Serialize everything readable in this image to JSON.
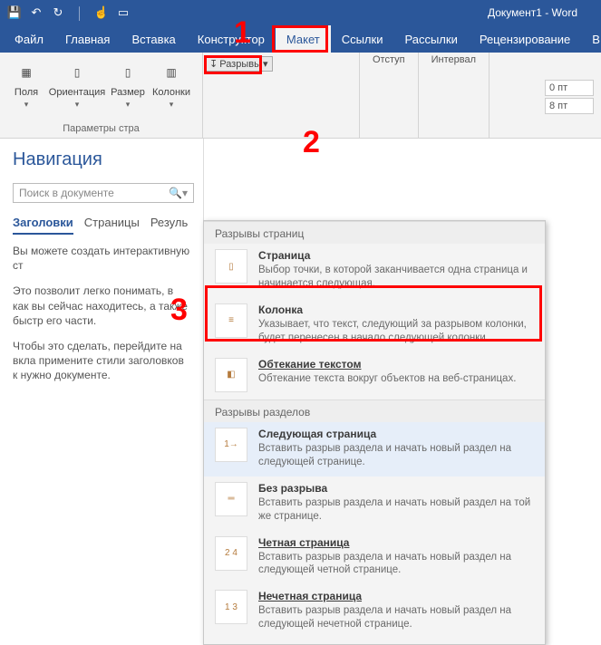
{
  "title": "Документ1 - Word",
  "qat": [
    "save",
    "undo",
    "redo",
    "touch",
    "new"
  ],
  "tabs": [
    "Файл",
    "Главная",
    "Вставка",
    "Конструктор",
    "Макет",
    "Ссылки",
    "Рассылки",
    "Рецензирование",
    "В"
  ],
  "active_tab": 4,
  "ribbon": {
    "group1_label": "Параметры стра",
    "btn_fields": "Поля",
    "btn_orient": "Ориентация",
    "btn_size": "Размер",
    "btn_cols": "Колонки",
    "breaks_btn": "Разрывы",
    "indent_label": "Отступ",
    "interval_label": "Интервал",
    "int_before": "0 пт",
    "int_after": "8 пт"
  },
  "nav": {
    "title": "Навигация",
    "search_placeholder": "Поиск в документе",
    "tabs": [
      "Заголовки",
      "Страницы",
      "Резуль"
    ],
    "active": 0,
    "p1": "Вы можете создать интерактивную ст",
    "p2": "Это позволит легко понимать, в как вы сейчас находитесь, а также быстр его части.",
    "p3": "Чтобы это сделать, перейдите на вкла примените стили заголовков к нужно документе."
  },
  "dropdown": {
    "sec1": "Разрывы страниц",
    "sec2": "Разрывы разделов",
    "items1": [
      {
        "t": "Страница",
        "d": "Выбор точки, в которой заканчивается одна страница и начинается следующая."
      },
      {
        "t": "Колонка",
        "d": "Указывает, что текст, следующий за разрывом колонки, будет перенесен в начало следующей колонки."
      },
      {
        "t": "Обтекание текстом",
        "d": "Обтекание текста вокруг объектов на веб-страницах.",
        "u": true
      }
    ],
    "items2": [
      {
        "t": "Следующая страница",
        "d": "Вставить разрыв раздела и начать новый раздел на следующей странице."
      },
      {
        "t": "Без разрыва",
        "d": "Вставить разрыв раздела и начать новый раздел на той же странице."
      },
      {
        "t": "Четная страница",
        "d": "Вставить разрыв раздела и начать новый раздел на следующей четной странице.",
        "u": true
      },
      {
        "t": "Нечетная страница",
        "d": "Вставить разрыв раздела и начать новый раздел на следующей нечетной странице.",
        "u": true
      }
    ]
  },
  "annot": {
    "n1": "1",
    "n2": "2",
    "n3": "3"
  }
}
